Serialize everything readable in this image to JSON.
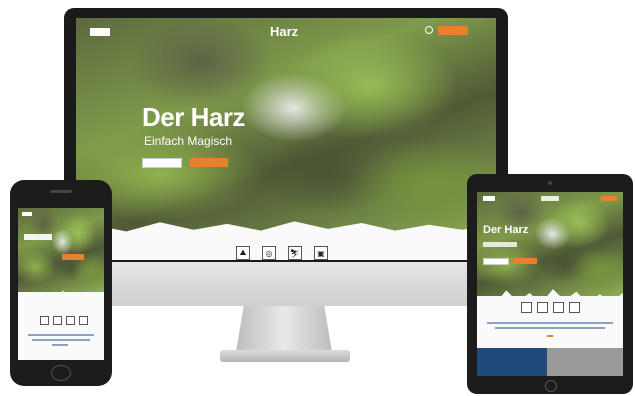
{
  "desktop": {
    "logo": "Harz",
    "hero_title": "Der Harz",
    "hero_subtitle": "Einfach Magisch",
    "icons": [
      "hiking-icon",
      "bike-icon",
      "ski-icon",
      "camera-icon"
    ]
  },
  "tablet": {
    "hero_title": "Der Harz"
  },
  "phone": {},
  "colors": {
    "accent": "#e8822a",
    "tablet_left_bar": "#1f4a7a",
    "tablet_right_bar": "#9a9a9a"
  }
}
